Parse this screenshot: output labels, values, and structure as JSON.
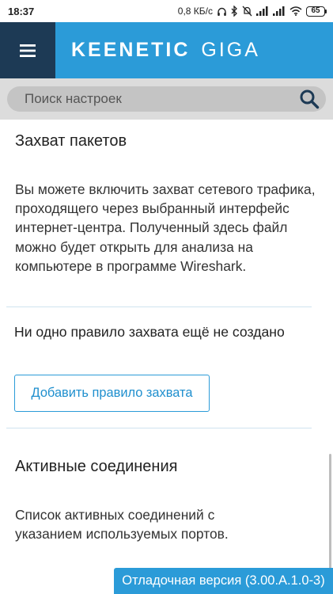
{
  "status_bar": {
    "time": "18:37",
    "net_speed": "0,8 КБ/с",
    "battery": "65"
  },
  "header": {
    "brand": "KEENETIC",
    "model": "GIGA",
    "menu_icon": "hamburger-icon",
    "color_header": "#2b9bd8",
    "color_menu": "#1d3a55"
  },
  "search": {
    "placeholder": "Поиск настроек",
    "value": "",
    "icon": "search-icon"
  },
  "capture": {
    "title": "Захват пакетов",
    "description": "Вы можете включить захват сетевого трафика, проходящего через выбранный интерфейс интернет-центра. Полученный здесь файл можно будет открыть для анализа на компьютере в программе Wireshark.",
    "empty_note": "Ни одно правило захвата ещё не создано",
    "add_button": "Добавить правило захвата"
  },
  "connections": {
    "title": "Активные соединения",
    "description": "Список активных соединений с указанием используемых портов."
  },
  "footer": {
    "debug_label": "Отладочная версия (3.00.A.1.0-3)"
  }
}
